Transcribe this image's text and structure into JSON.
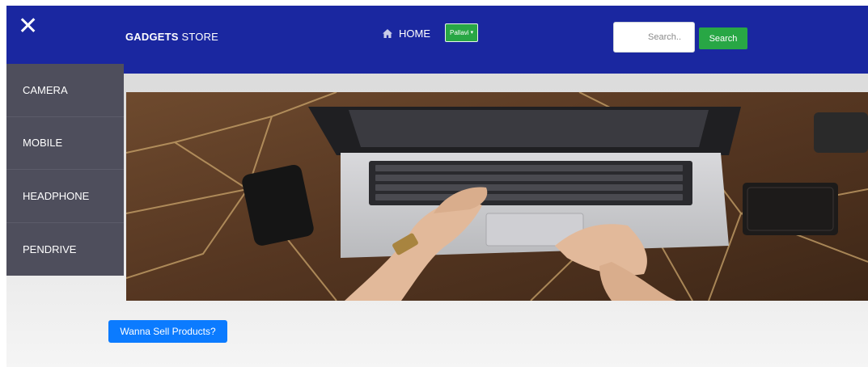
{
  "navbar": {
    "close_symbol": "✕",
    "brand_bold": "GADGETS",
    "brand_rest": " STORE",
    "home_label": "HOME",
    "user_name": "Pallavi",
    "caret": "▾",
    "search_placeholder": "Search..",
    "search_button": "Search",
    "colors": {
      "navbar_bg": "#1a27a0",
      "accent_green": "#28a745"
    }
  },
  "sidebar": {
    "items": [
      {
        "label": "CAMERA"
      },
      {
        "label": "MOBILE"
      },
      {
        "label": "HEADPHONE"
      },
      {
        "label": "PENDRIVE"
      }
    ]
  },
  "hero": {
    "icon": "laptop-on-wooden-desk-photo"
  },
  "sell_button": "Wanna Sell Products?"
}
